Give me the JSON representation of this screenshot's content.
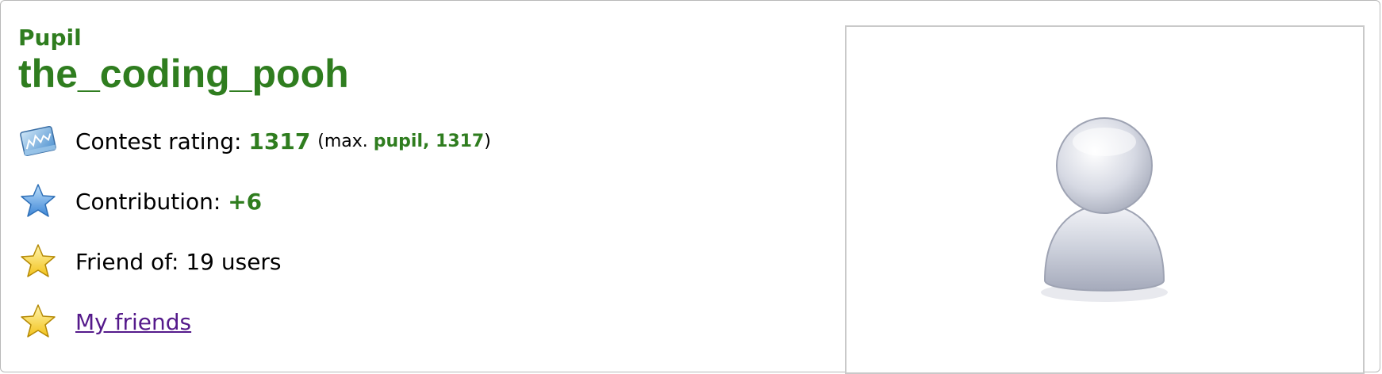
{
  "profile": {
    "rank": "Pupil",
    "handle": "the_coding_pooh",
    "rating": {
      "label": "Contest rating:",
      "value": "1317",
      "max_open": "(max.",
      "max_rank_value": "pupil, 1317",
      "max_close": ")"
    },
    "contribution": {
      "label": "Contribution:",
      "value": "+6"
    },
    "friend_of": {
      "text": "Friend of: 19 users"
    },
    "my_friends": {
      "label": "My friends"
    }
  },
  "icons": {
    "rating": "rating-graph-icon",
    "contribution": "blue-star-icon",
    "friend_of": "yellow-star-icon",
    "my_friends": "yellow-star-icon",
    "avatar": "default-user-avatar"
  },
  "colors": {
    "rank_green": "#2f7d1f",
    "link_purple": "#551a8b",
    "frame_border": "#b9b9b9"
  }
}
